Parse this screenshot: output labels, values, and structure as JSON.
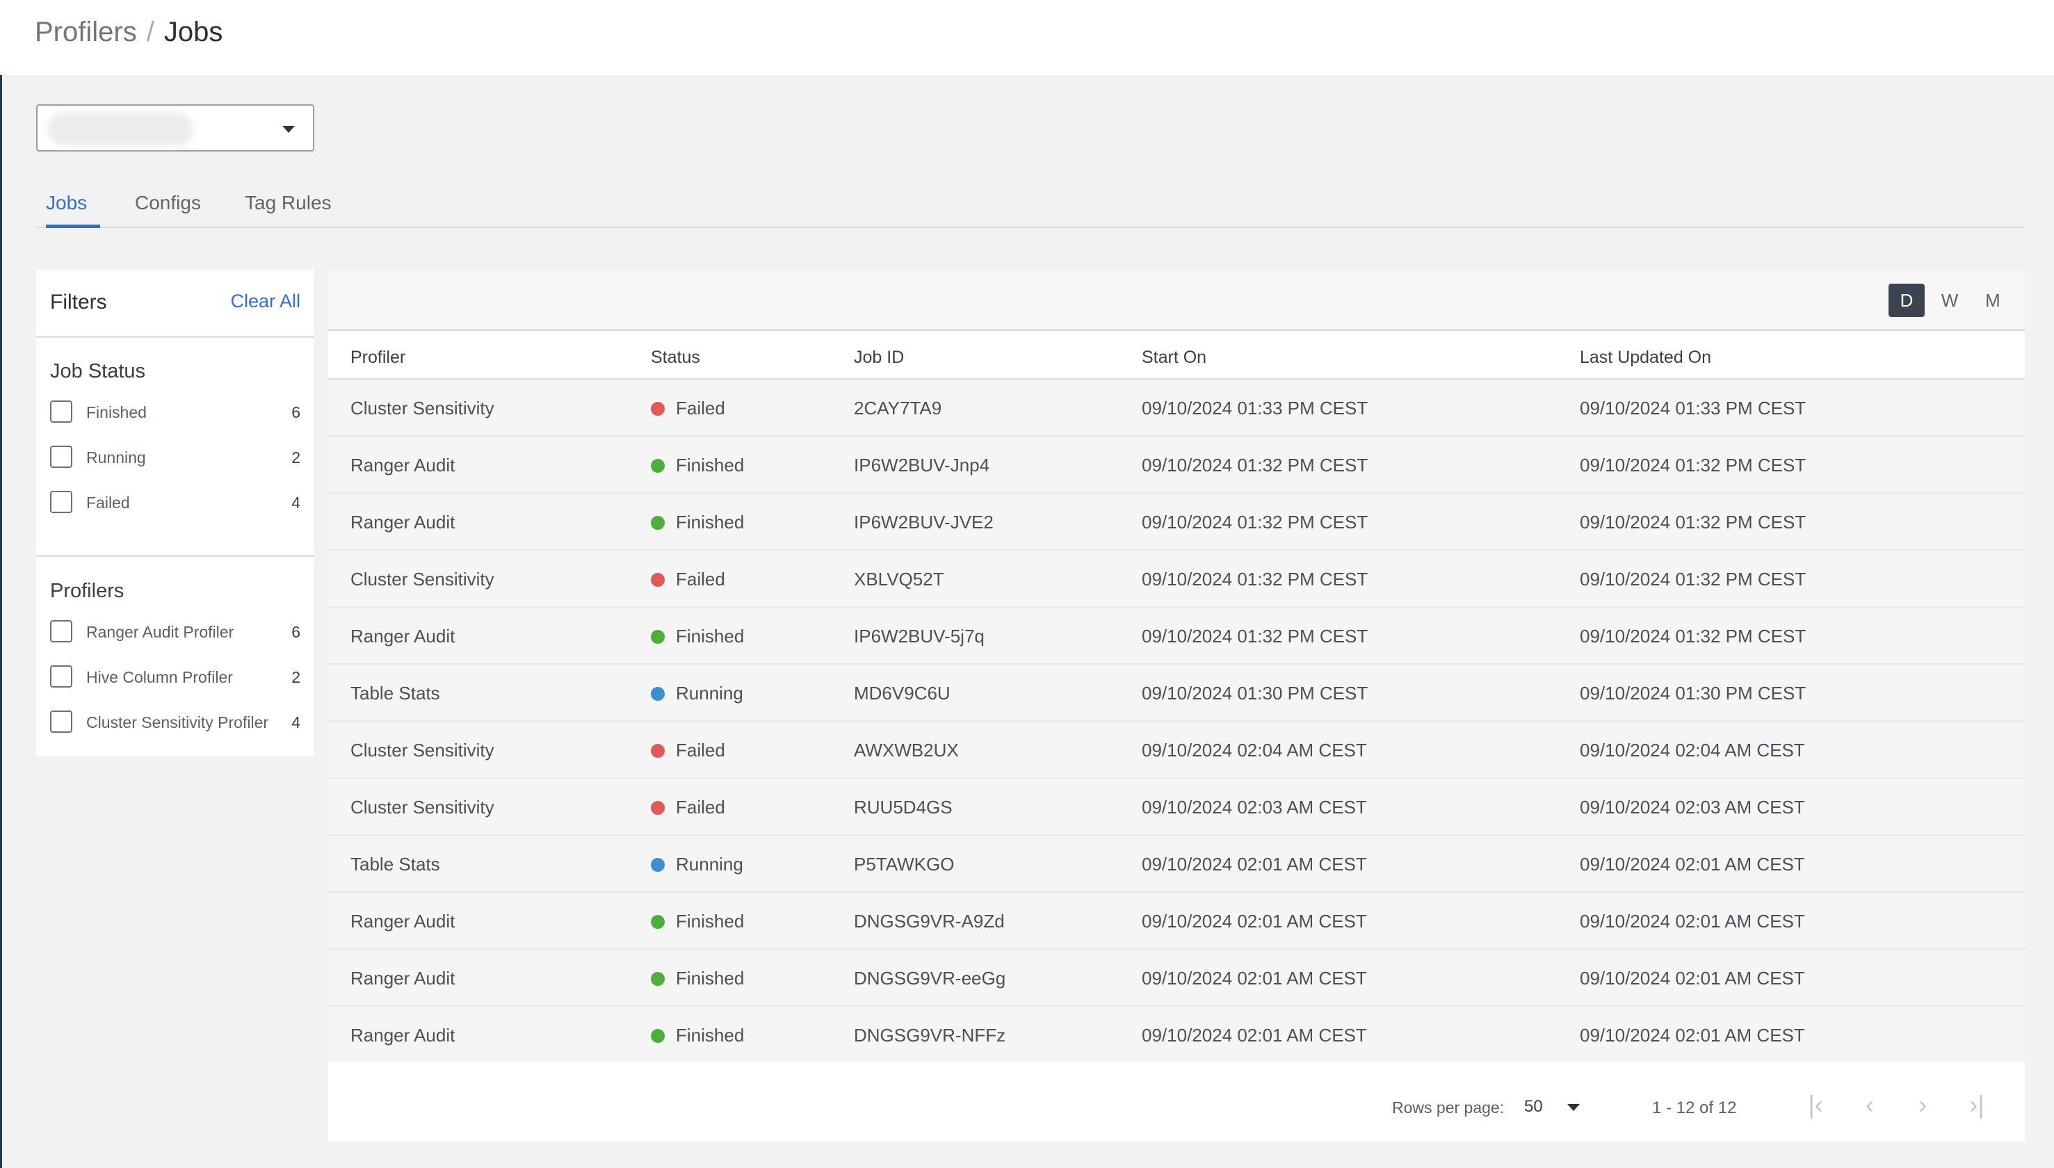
{
  "breadcrumb": {
    "parent": "Profilers",
    "separator": "/",
    "current": "Jobs"
  },
  "tabs": [
    {
      "label": "Jobs",
      "active": true
    },
    {
      "label": "Configs",
      "active": false
    },
    {
      "label": "Tag Rules",
      "active": false
    }
  ],
  "filters": {
    "title": "Filters",
    "clear_all": "Clear All",
    "job_status": {
      "title": "Job Status",
      "items": [
        {
          "label": "Finished",
          "count": "6",
          "checked": false
        },
        {
          "label": "Running",
          "count": "2",
          "checked": false
        },
        {
          "label": "Failed",
          "count": "4",
          "checked": false
        }
      ]
    },
    "profilers": {
      "title": "Profilers",
      "items": [
        {
          "label": "Ranger Audit Profiler",
          "count": "6",
          "checked": false
        },
        {
          "label": "Hive Column Profiler",
          "count": "2",
          "checked": false
        },
        {
          "label": "Cluster Sensitivity Profiler",
          "count": "4",
          "checked": false
        }
      ]
    }
  },
  "range_buttons": [
    {
      "label": "D",
      "active": true
    },
    {
      "label": "W",
      "active": false
    },
    {
      "label": "M",
      "active": false
    }
  ],
  "table": {
    "columns": [
      "Profiler",
      "Status",
      "Job ID",
      "Start On",
      "Last Updated On"
    ],
    "rows": [
      {
        "profiler": "Cluster Sensitivity",
        "status": "Failed",
        "job_id": "2CAY7TA9",
        "start_on": "09/10/2024 01:33 PM CEST",
        "last_updated": "09/10/2024 01:33 PM CEST"
      },
      {
        "profiler": "Ranger Audit",
        "status": "Finished",
        "job_id": "IP6W2BUV-Jnp4",
        "start_on": "09/10/2024 01:32 PM CEST",
        "last_updated": "09/10/2024 01:32 PM CEST"
      },
      {
        "profiler": "Ranger Audit",
        "status": "Finished",
        "job_id": "IP6W2BUV-JVE2",
        "start_on": "09/10/2024 01:32 PM CEST",
        "last_updated": "09/10/2024 01:32 PM CEST"
      },
      {
        "profiler": "Cluster Sensitivity",
        "status": "Failed",
        "job_id": "XBLVQ52T",
        "start_on": "09/10/2024 01:32 PM CEST",
        "last_updated": "09/10/2024 01:32 PM CEST"
      },
      {
        "profiler": "Ranger Audit",
        "status": "Finished",
        "job_id": "IP6W2BUV-5j7q",
        "start_on": "09/10/2024 01:32 PM CEST",
        "last_updated": "09/10/2024 01:32 PM CEST"
      },
      {
        "profiler": "Table Stats",
        "status": "Running",
        "job_id": "MD6V9C6U",
        "start_on": "09/10/2024 01:30 PM CEST",
        "last_updated": "09/10/2024 01:30 PM CEST"
      },
      {
        "profiler": "Cluster Sensitivity",
        "status": "Failed",
        "job_id": "AWXWB2UX",
        "start_on": "09/10/2024 02:04 AM CEST",
        "last_updated": "09/10/2024 02:04 AM CEST"
      },
      {
        "profiler": "Cluster Sensitivity",
        "status": "Failed",
        "job_id": "RUU5D4GS",
        "start_on": "09/10/2024 02:03 AM CEST",
        "last_updated": "09/10/2024 02:03 AM CEST"
      },
      {
        "profiler": "Table Stats",
        "status": "Running",
        "job_id": "P5TAWKGO",
        "start_on": "09/10/2024 02:01 AM CEST",
        "last_updated": "09/10/2024 02:01 AM CEST"
      },
      {
        "profiler": "Ranger Audit",
        "status": "Finished",
        "job_id": "DNGSG9VR-A9Zd",
        "start_on": "09/10/2024 02:01 AM CEST",
        "last_updated": "09/10/2024 02:01 AM CEST"
      },
      {
        "profiler": "Ranger Audit",
        "status": "Finished",
        "job_id": "DNGSG9VR-eeGg",
        "start_on": "09/10/2024 02:01 AM CEST",
        "last_updated": "09/10/2024 02:01 AM CEST"
      },
      {
        "profiler": "Ranger Audit",
        "status": "Finished",
        "job_id": "DNGSG9VR-NFFz",
        "start_on": "09/10/2024 02:01 AM CEST",
        "last_updated": "09/10/2024 02:01 AM CEST"
      }
    ]
  },
  "status_colors": {
    "Failed": "#e05a5a",
    "Finished": "#4caf3a",
    "Running": "#3d8fd1"
  },
  "pagination": {
    "rows_per_page_label": "Rows per page:",
    "rows_per_page_value": "50",
    "range_text": "1 - 12 of 12",
    "icons": [
      "first-page-icon",
      "previous-page-icon",
      "next-page-icon",
      "last-page-icon"
    ]
  }
}
